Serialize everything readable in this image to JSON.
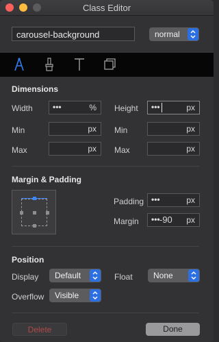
{
  "window": {
    "title": "Class Editor"
  },
  "class_name": {
    "value": "carousel-background"
  },
  "state_select": {
    "value": "normal"
  },
  "tabs": [
    {
      "name": "dimensions-tab",
      "icon": "compass-icon"
    },
    {
      "name": "brush-tab",
      "icon": "brush-icon"
    },
    {
      "name": "text-tab",
      "icon": "text-icon"
    },
    {
      "name": "border-tab",
      "icon": "layers-icon"
    }
  ],
  "dimensions": {
    "title": "Dimensions",
    "width": {
      "label": "Width",
      "dots": "•••",
      "unit": "%"
    },
    "height": {
      "label": "Height",
      "dots": "•••",
      "unit": "px"
    },
    "min_w": {
      "label": "Min",
      "unit": "px"
    },
    "min_h": {
      "label": "Min",
      "unit": "px"
    },
    "max_w": {
      "label": "Max",
      "unit": "px"
    },
    "max_h": {
      "label": "Max",
      "unit": "px"
    }
  },
  "margin_padding": {
    "title": "Margin & Padding",
    "padding": {
      "label": "Padding",
      "dots": "•••",
      "unit": "px"
    },
    "margin": {
      "label": "Margin",
      "dots": "•••",
      "value": "-90",
      "unit": "px"
    }
  },
  "position": {
    "title": "Position",
    "display": {
      "label": "Display",
      "value": "Default"
    },
    "float": {
      "label": "Float",
      "value": "None"
    },
    "overflow": {
      "label": "Overflow",
      "value": "Visible"
    }
  },
  "buttons": {
    "delete": "Delete",
    "done": "Done"
  },
  "colors": {
    "accent": "#2b6fe0",
    "delete_text": "#b04a48"
  }
}
